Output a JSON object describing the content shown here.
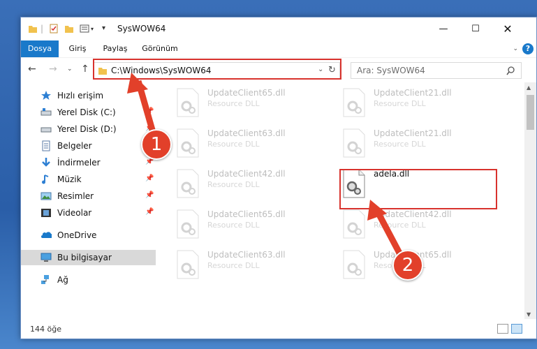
{
  "window": {
    "title": "SysWOW64"
  },
  "ribbon": {
    "tabs": [
      "Dosya",
      "Giriş",
      "Paylaş",
      "Görünüm"
    ]
  },
  "address": {
    "path": "C:\\Windows\\SysWOW64"
  },
  "search": {
    "placeholder": "Ara: SysWOW64"
  },
  "sidebar": {
    "items": [
      {
        "label": "Hızlı erişim",
        "icon": "star-icon",
        "pinned": false
      },
      {
        "label": "Yerel Disk (C:)",
        "icon": "drive-icon",
        "pinned": true
      },
      {
        "label": "Yerel Disk (D:)",
        "icon": "drive-icon",
        "pinned": true
      },
      {
        "label": "Belgeler",
        "icon": "documents-icon",
        "pinned": true
      },
      {
        "label": "İndirmeler",
        "icon": "download-icon",
        "pinned": true
      },
      {
        "label": "Müzik",
        "icon": "music-icon",
        "pinned": true
      },
      {
        "label": "Resimler",
        "icon": "pictures-icon",
        "pinned": true
      },
      {
        "label": "Videolar",
        "icon": "videos-icon",
        "pinned": true
      },
      {
        "label": "OneDrive",
        "icon": "onedrive-icon",
        "pinned": false
      },
      {
        "label": "Bu bilgisayar",
        "icon": "computer-icon",
        "pinned": false,
        "selected": true
      },
      {
        "label": "Ağ",
        "icon": "network-icon",
        "pinned": false
      }
    ]
  },
  "files": [
    {
      "name": "UpdateClient65.dll",
      "type": "Resource DLL",
      "faded": true
    },
    {
      "name": "UpdateClient21.dll",
      "type": "Resource DLL",
      "faded": true
    },
    {
      "name": "UpdateClient63.dll",
      "type": "Resource DLL",
      "faded": true
    },
    {
      "name": "UpdateClient21.dll",
      "type": "Resource DLL",
      "faded": true
    },
    {
      "name": "UpdateClient42.dll",
      "type": "Resource DLL",
      "faded": true
    },
    {
      "name": "adela.dll",
      "type": "",
      "faded": false
    },
    {
      "name": "UpdateClient65.dll",
      "type": "Resource DLL",
      "faded": true
    },
    {
      "name": "UpdateClient42.dll",
      "type": "Resource DLL",
      "faded": true
    },
    {
      "name": "UpdateClient63.dll",
      "type": "Resource DLL",
      "faded": true
    },
    {
      "name": "UpdateClient65.dll",
      "type": "Resource DLL",
      "faded": true
    }
  ],
  "status": {
    "count": "144 öğe"
  },
  "annotations": {
    "step1": "1",
    "step2": "2",
    "color": "#d8322d"
  }
}
